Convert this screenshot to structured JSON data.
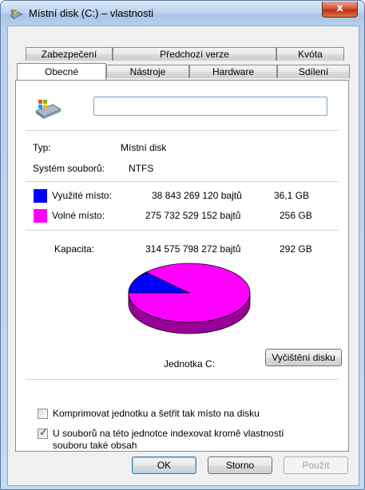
{
  "window": {
    "title": "Místní disk (C:) – vlastnosti",
    "close_label": "x"
  },
  "tabs": {
    "row1": [
      "Zabezpečení",
      "Předchozí verze",
      "Kvóta"
    ],
    "row2": [
      "Obecné",
      "Nástroje",
      "Hardware",
      "Sdílení"
    ],
    "active": "Obecné"
  },
  "general": {
    "name_value": "",
    "type_label": "Typ:",
    "type_value": "Místní disk",
    "fs_label": "Systém souborů:",
    "fs_value": "NTFS",
    "used": {
      "label": "Využité místo:",
      "bytes": "38 843 269 120 bajtů",
      "size": "36,1 GB",
      "color": "#0000ff"
    },
    "free": {
      "label": "Volné místo:",
      "bytes": "275 732 529 152 bajtů",
      "size": "256 GB",
      "color": "#ff00ff"
    },
    "capacity": {
      "label": "Kapacita:",
      "bytes": "314 575 798 272 bajtů",
      "size": "292 GB"
    },
    "used_fraction": 0.1235,
    "drive_label": "Jednotka C:",
    "cleanup_button": "Vyčištění disku"
  },
  "options": {
    "compress_label": "Komprimovat jednotku a šetřit tak místo na disku",
    "compress_checked": false,
    "index_label_line1": "U souborů na této jednotce indexovat kromě vlastností",
    "index_label_line2": "souboru také obsah",
    "index_checked": true
  },
  "buttons": {
    "ok": "OK",
    "cancel": "Storno",
    "apply": "Použít"
  }
}
